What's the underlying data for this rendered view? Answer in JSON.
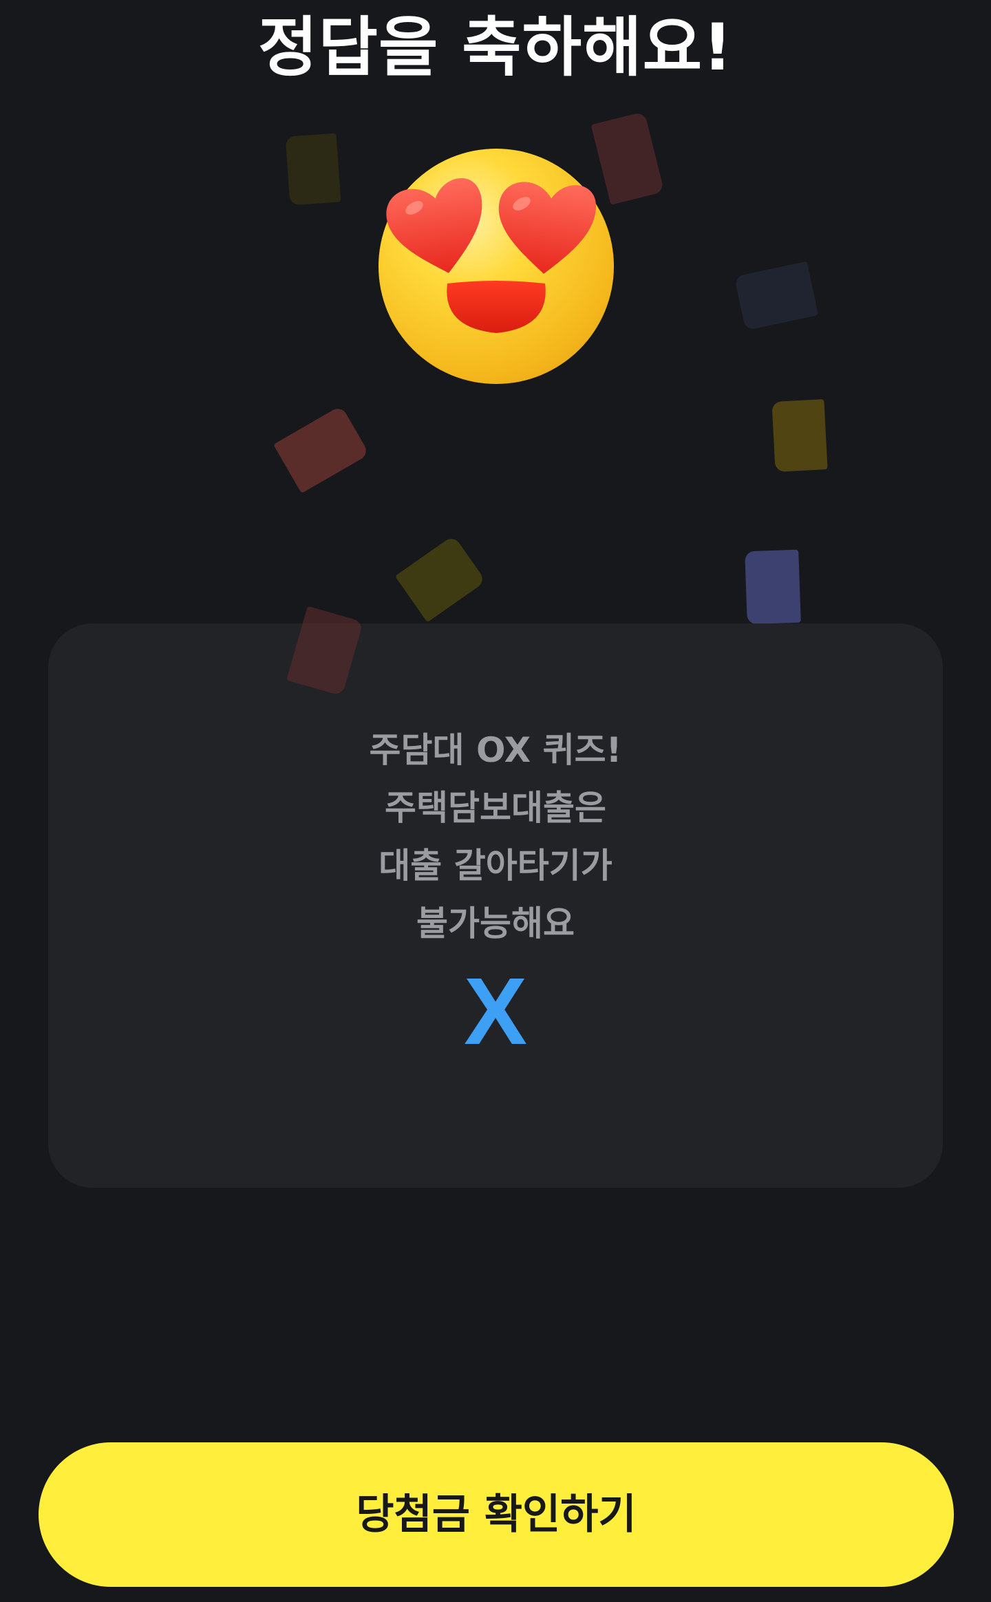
{
  "header": {
    "title": "정답을 축하해요!"
  },
  "celebration": {
    "emoji": "smiling-face-with-heart-eyes-icon",
    "confetti_colors": [
      "#2c2a14",
      "#432426",
      "#1f2430",
      "#4f4412",
      "#5a2c2a",
      "#3e3a12",
      "#3c4170",
      "#5a2c2c"
    ]
  },
  "quiz_card": {
    "question_lines": [
      "주담대 OX 퀴즈!",
      "주택담보대출은",
      "대출 갈아타기가",
      "불가능해요"
    ],
    "answer": "X"
  },
  "footer": {
    "cta_label": "당첨금 확인하기"
  },
  "colors": {
    "background": "#17181c",
    "card": "#222327",
    "answer": "#3ea0f5",
    "cta": "#ffee3c"
  }
}
